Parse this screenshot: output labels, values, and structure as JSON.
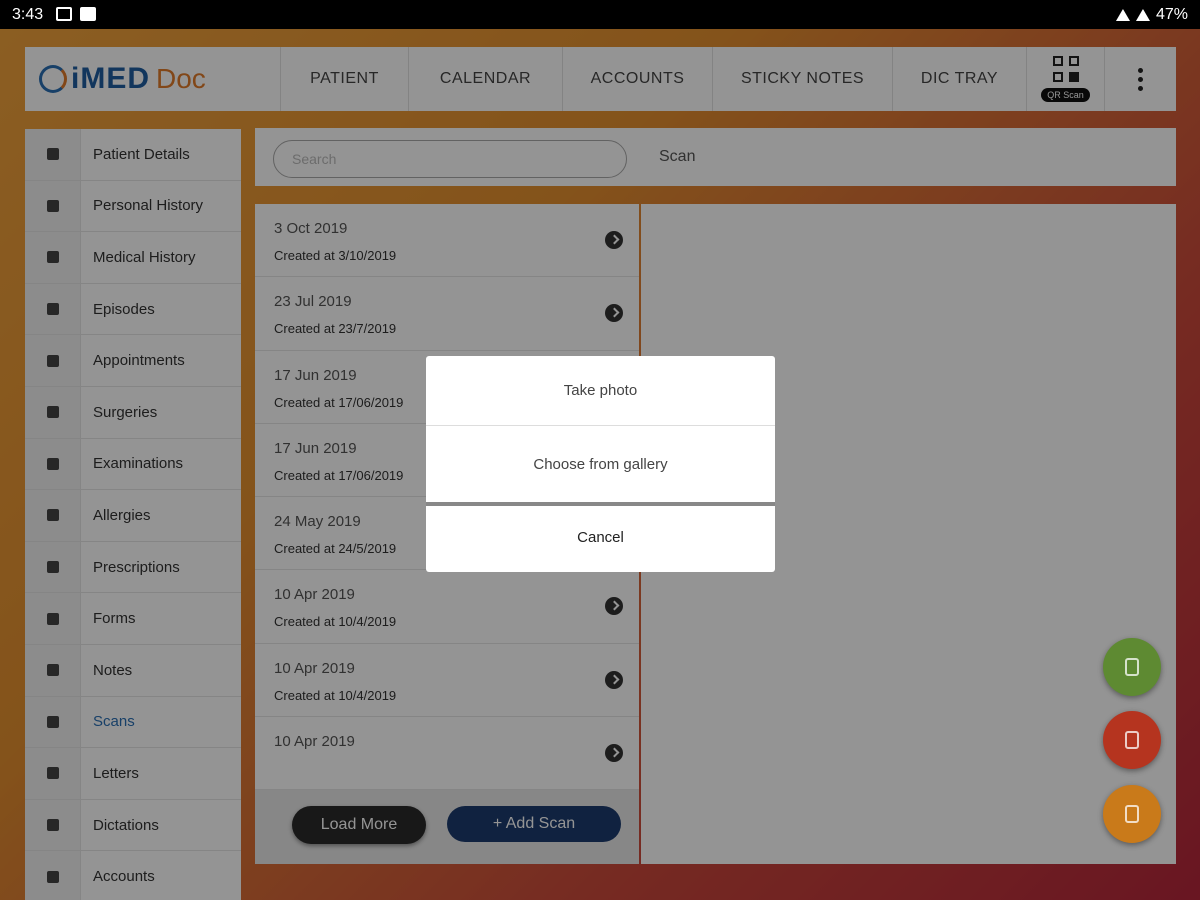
{
  "status_bar": {
    "time": "3:43",
    "battery": "47%"
  },
  "header": {
    "logo_main": "iMED",
    "logo_sub": "Doc",
    "nav": [
      "PATIENT",
      "CALENDAR",
      "ACCOUNTS",
      "STICKY NOTES",
      "DIC TRAY"
    ],
    "qr_label": "QR Scan"
  },
  "sidebar": {
    "items": [
      {
        "label": "Patient Details",
        "icon": "person-icon"
      },
      {
        "label": "Personal History",
        "icon": "history-icon"
      },
      {
        "label": "Medical History",
        "icon": "book-icon"
      },
      {
        "label": "Episodes",
        "icon": "cube-icon"
      },
      {
        "label": "Appointments",
        "icon": "clock-icon"
      },
      {
        "label": "Surgeries",
        "icon": "scissors-icon"
      },
      {
        "label": "Examinations",
        "icon": "pencil-icon"
      },
      {
        "label": "Allergies",
        "icon": "file-icon"
      },
      {
        "label": "Prescriptions",
        "icon": "pen-icon"
      },
      {
        "label": "Forms",
        "icon": "form-icon"
      },
      {
        "label": "Notes",
        "icon": "note-icon"
      },
      {
        "label": "Scans",
        "icon": "image-icon",
        "active": true
      },
      {
        "label": "Letters",
        "icon": "letter-icon"
      },
      {
        "label": "Dictations",
        "icon": "mic-icon"
      },
      {
        "label": "Accounts",
        "icon": "money-icon"
      }
    ]
  },
  "search": {
    "placeholder": "Search",
    "title": "Scan"
  },
  "scans": [
    {
      "date": "3 Oct 2019",
      "created": "Created at 3/10/2019"
    },
    {
      "date": "23 Jul 2019",
      "created": "Created at 23/7/2019"
    },
    {
      "date": "17 Jun 2019",
      "created": "Created at 17/06/2019"
    },
    {
      "date": "17 Jun 2019",
      "created": "Created at 17/06/2019"
    },
    {
      "date": "24 May 2019",
      "created": "Created at 24/5/2019"
    },
    {
      "date": "10 Apr 2019",
      "created": "Created at 10/4/2019"
    },
    {
      "date": "10 Apr 2019",
      "created": "Created at 10/4/2019"
    },
    {
      "date": "10 Apr 2019",
      "created": ""
    }
  ],
  "buttons": {
    "load_more": "Load More",
    "add_scan": "+ Add Scan"
  },
  "modal": {
    "take_photo": "Take photo",
    "choose_gallery": "Choose from gallery",
    "cancel": "Cancel"
  },
  "colors": {
    "brand_blue": "#1f5ea0",
    "brand_orange": "#e07b2a",
    "active_link": "#2a6fb4",
    "fab_mic": "#5e8a32",
    "fab_print": "#b5341f",
    "fab_doc": "#c97a1a"
  }
}
